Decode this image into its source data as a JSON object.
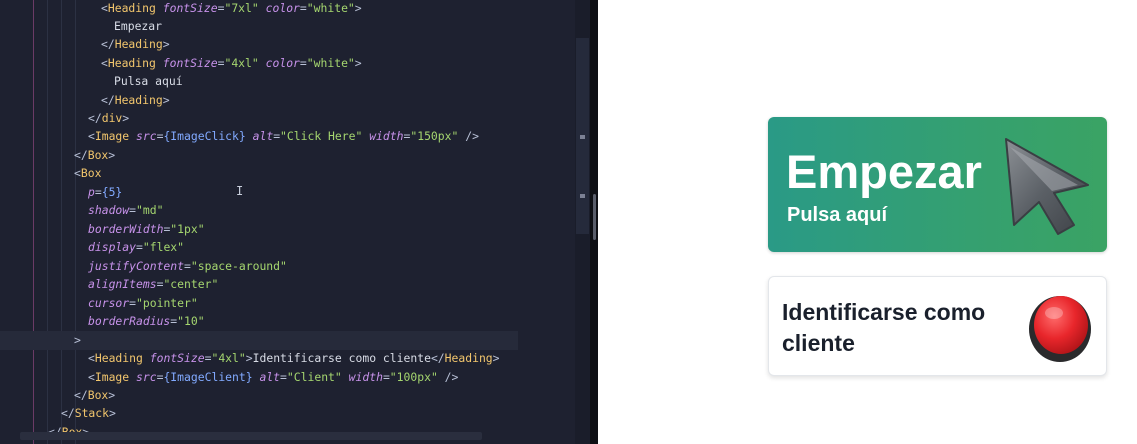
{
  "editor": {
    "lines": [
      [
        [
          "tag",
          "<"
        ],
        [
          "tagname",
          "Heading"
        ],
        [
          "sp",
          " "
        ],
        [
          "attr",
          "fontSize"
        ],
        [
          "punct",
          "="
        ],
        [
          "str",
          "\"7xl\""
        ],
        [
          "sp",
          " "
        ],
        [
          "attr",
          "color"
        ],
        [
          "punct",
          "="
        ],
        [
          "str",
          "\"white\""
        ],
        [
          "tag",
          ">"
        ]
      ],
      [
        [
          "txt",
          "Empezar"
        ]
      ],
      [
        [
          "tag",
          "</"
        ],
        [
          "tagname",
          "Heading"
        ],
        [
          "tag",
          ">"
        ]
      ],
      [
        [
          "tag",
          "<"
        ],
        [
          "tagname",
          "Heading"
        ],
        [
          "sp",
          " "
        ],
        [
          "attr",
          "fontSize"
        ],
        [
          "punct",
          "="
        ],
        [
          "str",
          "\"4xl\""
        ],
        [
          "sp",
          " "
        ],
        [
          "attr",
          "color"
        ],
        [
          "punct",
          "="
        ],
        [
          "str",
          "\"white\""
        ],
        [
          "tag",
          ">"
        ]
      ],
      [
        [
          "txt",
          "Pulsa aquí"
        ]
      ],
      [
        [
          "tag",
          "</"
        ],
        [
          "tagname",
          "Heading"
        ],
        [
          "tag",
          ">"
        ]
      ],
      [
        [
          "tag",
          "</"
        ],
        [
          "tagname",
          "div"
        ],
        [
          "tag",
          ">"
        ]
      ],
      [
        [
          "tag",
          "<"
        ],
        [
          "tagname",
          "Image"
        ],
        [
          "sp",
          " "
        ],
        [
          "attr",
          "src"
        ],
        [
          "punct",
          "="
        ],
        [
          "expr",
          "{ImageClick}"
        ],
        [
          "sp",
          " "
        ],
        [
          "attr",
          "alt"
        ],
        [
          "punct",
          "="
        ],
        [
          "str",
          "\"Click Here\""
        ],
        [
          "sp",
          " "
        ],
        [
          "attr",
          "width"
        ],
        [
          "punct",
          "="
        ],
        [
          "str",
          "\"150px\""
        ],
        [
          "sp",
          " "
        ],
        [
          "tag",
          "/>"
        ]
      ],
      [
        [
          "tag",
          "</"
        ],
        [
          "tagname",
          "Box"
        ],
        [
          "tag",
          ">"
        ]
      ],
      [
        [
          "tag",
          "<"
        ],
        [
          "tagname",
          "Box"
        ]
      ],
      [
        [
          "attr",
          "p"
        ],
        [
          "punct",
          "="
        ],
        [
          "expr",
          "{5}"
        ]
      ],
      [
        [
          "attr",
          "shadow"
        ],
        [
          "punct",
          "="
        ],
        [
          "str",
          "\"md\""
        ]
      ],
      [
        [
          "attr",
          "borderWidth"
        ],
        [
          "punct",
          "="
        ],
        [
          "str",
          "\"1px\""
        ]
      ],
      [
        [
          "attr",
          "display"
        ],
        [
          "punct",
          "="
        ],
        [
          "str",
          "\"flex\""
        ]
      ],
      [
        [
          "attr",
          "justifyContent"
        ],
        [
          "punct",
          "="
        ],
        [
          "str",
          "\"space-around\""
        ]
      ],
      [
        [
          "attr",
          "alignItems"
        ],
        [
          "punct",
          "="
        ],
        [
          "str",
          "\"center\""
        ]
      ],
      [
        [
          "attr",
          "cursor"
        ],
        [
          "punct",
          "="
        ],
        [
          "str",
          "\"pointer\""
        ]
      ],
      [
        [
          "attr",
          "borderRadius"
        ],
        [
          "punct",
          "="
        ],
        [
          "str",
          "\"10\""
        ]
      ],
      [
        [
          "tag",
          ">"
        ]
      ],
      [
        [
          "tag",
          "<"
        ],
        [
          "tagname",
          "Heading"
        ],
        [
          "sp",
          " "
        ],
        [
          "attr",
          "fontSize"
        ],
        [
          "punct",
          "="
        ],
        [
          "str",
          "\"4xl\""
        ],
        [
          "tag",
          ">"
        ],
        [
          "txt",
          "Identificarse como cliente"
        ],
        [
          "tag",
          "</"
        ],
        [
          "tagname",
          "Heading"
        ],
        [
          "tag",
          ">"
        ]
      ],
      [
        [
          "tag",
          "<"
        ],
        [
          "tagname",
          "Image"
        ],
        [
          "sp",
          " "
        ],
        [
          "attr",
          "src"
        ],
        [
          "punct",
          "="
        ],
        [
          "expr",
          "{ImageClient}"
        ],
        [
          "sp",
          " "
        ],
        [
          "attr",
          "alt"
        ],
        [
          "punct",
          "="
        ],
        [
          "str",
          "\"Client\""
        ],
        [
          "sp",
          " "
        ],
        [
          "attr",
          "width"
        ],
        [
          "punct",
          "="
        ],
        [
          "str",
          "\"100px\""
        ],
        [
          "sp",
          " "
        ],
        [
          "tag",
          "/>"
        ]
      ],
      [
        [
          "tag",
          "</"
        ],
        [
          "tagname",
          "Box"
        ],
        [
          "tag",
          ">"
        ]
      ],
      [
        [
          "tag",
          "</"
        ],
        [
          "tagname",
          "Stack"
        ],
        [
          "tag",
          ">"
        ]
      ],
      [
        [
          "tag",
          "</"
        ],
        [
          "tagname",
          "Box"
        ],
        [
          "tag",
          ">"
        ]
      ]
    ],
    "text_cursor_glyph": "I",
    "active_line_index": 18
  },
  "preview": {
    "start_card": {
      "title": "Empezar",
      "subtitle": "Pulsa aquí",
      "image_icon": "mouse-pointer-icon",
      "gradient_from": "#2a9a86",
      "gradient_to": "#3aa364"
    },
    "client_card": {
      "title": "Identificarse como cliente",
      "image_icon": "red-push-button-icon",
      "button_color": "#e8262b"
    }
  }
}
